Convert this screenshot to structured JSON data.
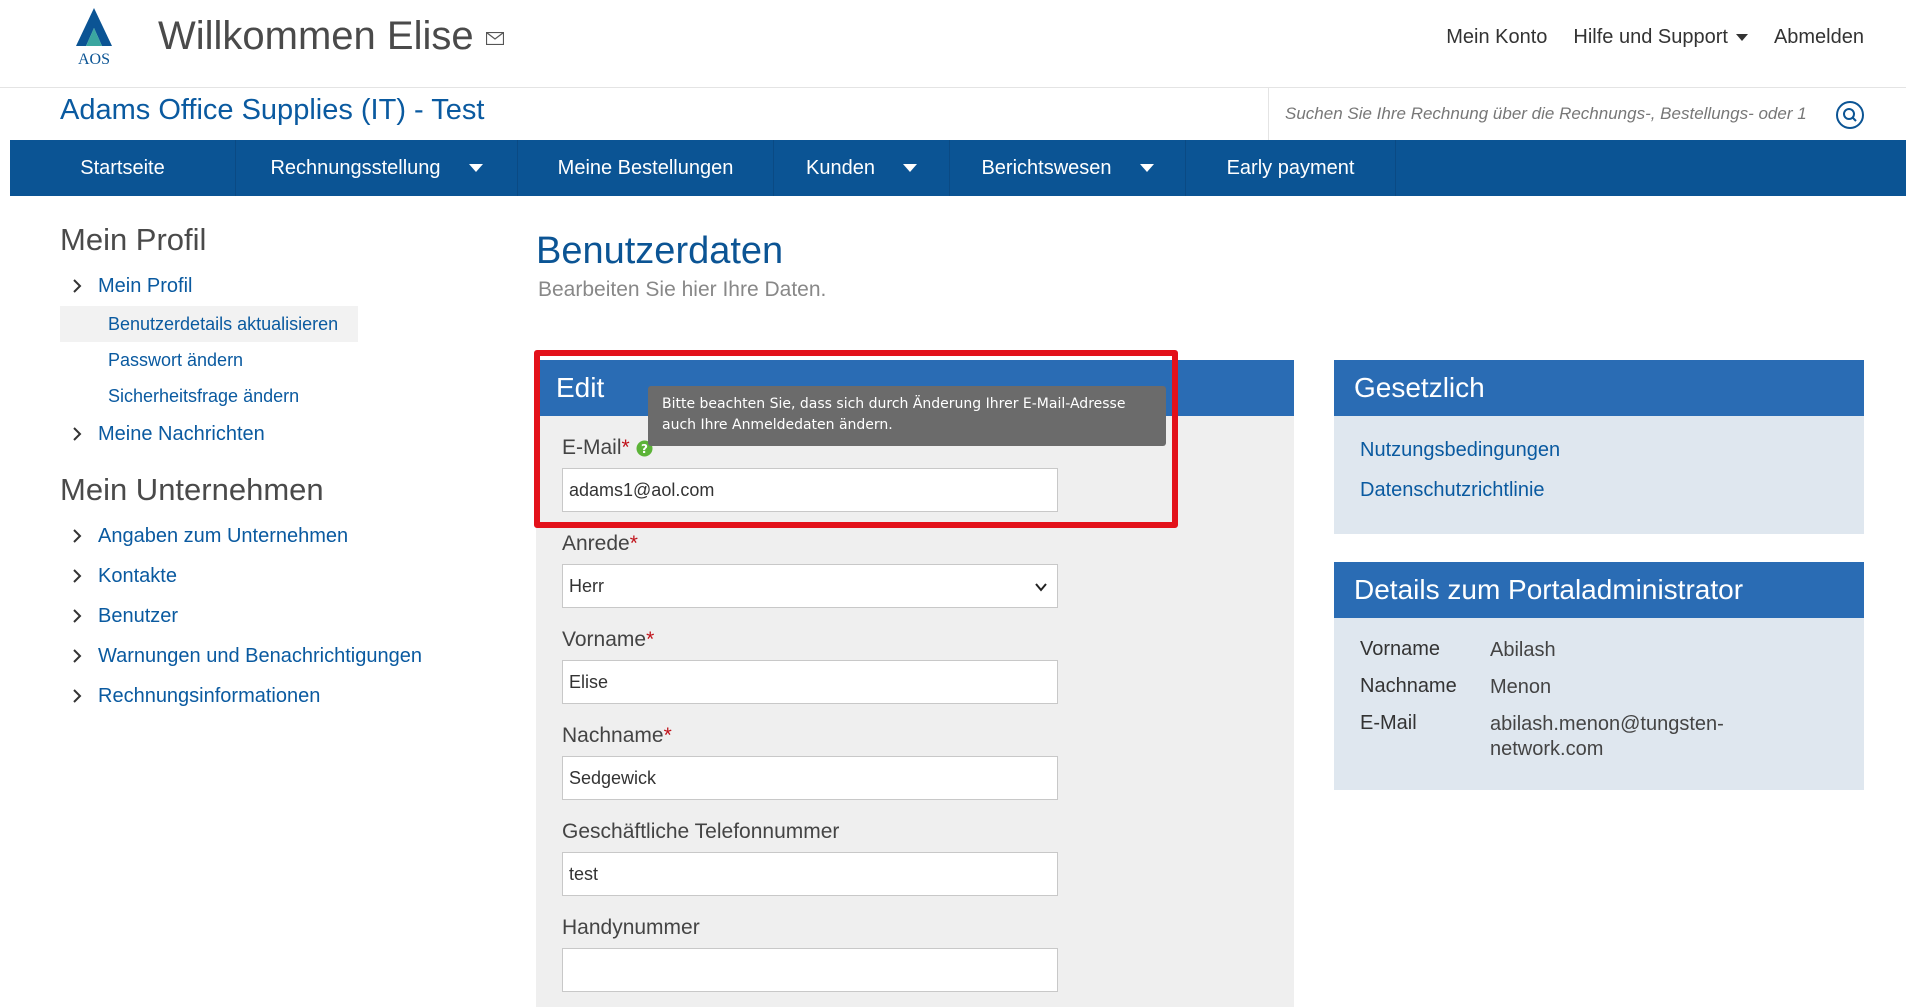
{
  "header": {
    "logo_text": "AOS",
    "welcome": "Willkommen Elise",
    "top_links": {
      "account": "Mein Konto",
      "help": "Hilfe und Support",
      "logout": "Abmelden"
    }
  },
  "subheader": {
    "company": "Adams Office Supplies (IT) - Test",
    "search_placeholder": "Suchen Sie Ihre Rechnung über die Rechnungs-, Bestellungs- oder 1"
  },
  "nav": {
    "items": [
      {
        "label": "Startseite",
        "dropdown": false
      },
      {
        "label": "Rechnungsstellung",
        "dropdown": true
      },
      {
        "label": "Meine Bestellungen",
        "dropdown": false
      },
      {
        "label": "Kunden",
        "dropdown": true
      },
      {
        "label": "Berichtswesen",
        "dropdown": true
      },
      {
        "label": "Early payment",
        "dropdown": false
      }
    ]
  },
  "sidebar": {
    "profile_heading": "Mein Profil",
    "profile_link": "Mein Profil",
    "profile_subs": [
      "Benutzerdetails aktualisieren",
      "Passwort ändern",
      "Sicherheitsfrage ändern"
    ],
    "messages_link": "Meine Nachrichten",
    "company_heading": "Mein Unternehmen",
    "company_links": [
      "Angaben zum Unternehmen",
      "Kontakte",
      "Benutzer",
      "Warnungen und Benachrichtigungen",
      "Rechnungsinformationen"
    ]
  },
  "main": {
    "title": "Benutzerdaten",
    "subtitle": "Bearbeiten Sie hier Ihre Daten.",
    "panel_title": "Edit",
    "tooltip": "Bitte beachten Sie, dass sich durch Änderung Ihrer E-Mail-Adresse auch Ihre Anmeldedaten ändern.",
    "fields": {
      "email_label": "E-Mail",
      "email_value": "adams1@aol.com",
      "salutation_label": "Anrede",
      "salutation_value": "Herr",
      "firstname_label": "Vorname",
      "firstname_value": "Elise",
      "lastname_label": "Nachname",
      "lastname_value": "Sedgewick",
      "phone_label": "Geschäftliche Telefonnummer",
      "phone_value": "test",
      "mobile_label": "Handynummer",
      "mobile_value": ""
    },
    "required_mark": "*"
  },
  "legal": {
    "title": "Gesetzlich",
    "links": [
      "Nutzungsbedingungen",
      "Datenschutzrichtlinie"
    ]
  },
  "admin": {
    "title": "Details zum Portaladministrator",
    "rows": [
      {
        "key": "Vorname",
        "value": "Abilash"
      },
      {
        "key": "Nachname",
        "value": "Menon"
      },
      {
        "key": "E-Mail",
        "value": "abilash.menon@tungsten-network.com"
      }
    ]
  },
  "colors": {
    "brand_blue": "#0b5494",
    "panel_blue": "#2a6cb4",
    "highlight_red": "#e3111a",
    "required_red": "#c0131b"
  }
}
